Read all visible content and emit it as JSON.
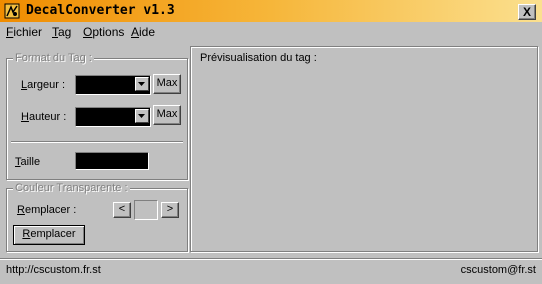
{
  "window": {
    "title": "DecalConverter v1.3",
    "close_label": "X"
  },
  "menu": [
    {
      "label": "Fichier",
      "mnemonic": "F",
      "rest": "ichier"
    },
    {
      "label": "Tag",
      "mnemonic": "T",
      "rest": "ag"
    },
    {
      "label": "Options",
      "mnemonic": "O",
      "rest": "ptions"
    },
    {
      "label": "Aide",
      "mnemonic": "A",
      "rest": "ide"
    }
  ],
  "format_group": {
    "title": "Format du Tag :",
    "largeur": {
      "mnemonic": "L",
      "rest": "argeur :",
      "label": "Largeur :"
    },
    "hauteur": {
      "mnemonic": "H",
      "rest": "auteur :",
      "label": "Hauteur :"
    },
    "max_label": "Max",
    "taille": {
      "mnemonic": "T",
      "rest": "aille",
      "label": "Taille"
    }
  },
  "couleur_group": {
    "title": "Couleur Transparente :",
    "remplacer_label": {
      "mnemonic": "R",
      "rest": "emplacer :",
      "label": "Remplacer :"
    },
    "prev_label": "<",
    "next_label": ">",
    "remplacer_button": {
      "mnemonic": "R",
      "rest": "emplacer",
      "label": "Remplacer"
    }
  },
  "preview_group": {
    "title": "Prévisualisation du tag :"
  },
  "status": {
    "left": "http://cscustom.fr.st",
    "right": "cscustom@fr.st"
  },
  "colors": {
    "face": "#c0c0c0",
    "title_start": "#f08c00",
    "title_end": "#fbe08f",
    "field": "#000000"
  }
}
